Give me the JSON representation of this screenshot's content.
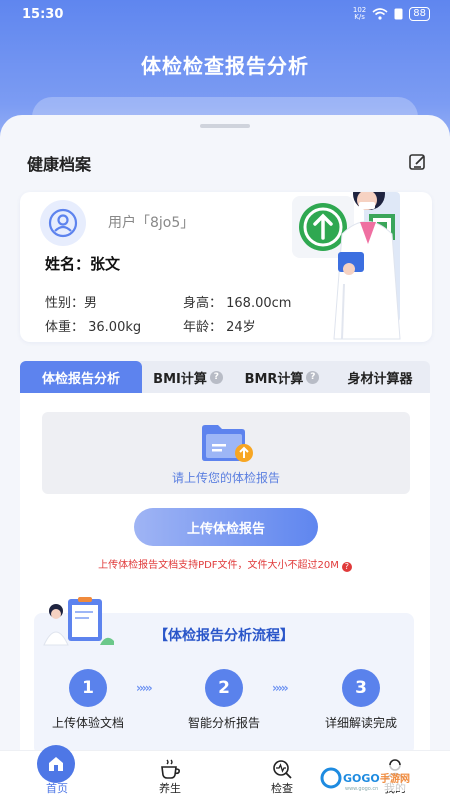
{
  "status_bar": {
    "time": "15:30",
    "net_speed_value": "102",
    "net_speed_unit": "K/s",
    "battery": "88"
  },
  "header": {
    "title": "体检检查报告分析"
  },
  "health_profile": {
    "title": "健康档案",
    "user_label": "用户「8jo5」",
    "name_label": "姓名：",
    "name_value": "张文",
    "gender": "性别：男",
    "height": "身高：  168.00cm",
    "weight": "体重：  36.00kg",
    "age": "年龄：  24岁"
  },
  "tabs": [
    {
      "label": "体检报告分析",
      "active": true,
      "help": false
    },
    {
      "label": "BMI计算",
      "active": false,
      "help": true
    },
    {
      "label": "BMR计算",
      "active": false,
      "help": true
    },
    {
      "label": "身材计算器",
      "active": false,
      "help": false
    }
  ],
  "upload": {
    "hint": "请上传您的体检报告",
    "button_label": "上传体检报告",
    "warning": "上传体检报告文档支持PDF文件，文件大小不超过20M"
  },
  "process": {
    "title": "【体检报告分析流程】",
    "steps": [
      {
        "number": "1",
        "label": "上传体验文档"
      },
      {
        "number": "2",
        "label": "智能分析报告"
      },
      {
        "number": "3",
        "label": "详细解读完成"
      }
    ],
    "arrow_glyph": "›››››"
  },
  "nav": [
    {
      "label": "首页",
      "icon": "home-icon",
      "active": true
    },
    {
      "label": "养生",
      "icon": "tea-cup-icon",
      "active": false
    },
    {
      "label": "检查",
      "icon": "checkup-icon",
      "active": false
    },
    {
      "label": "我的",
      "icon": "profile-icon",
      "active": false
    }
  ],
  "watermark": {
    "text": "GOGO手游网",
    "sub": "www.gogo.cn"
  },
  "colors": {
    "accent": "#5d83ee",
    "warning": "#e03a3a",
    "sheet": "#f4f6fb"
  }
}
